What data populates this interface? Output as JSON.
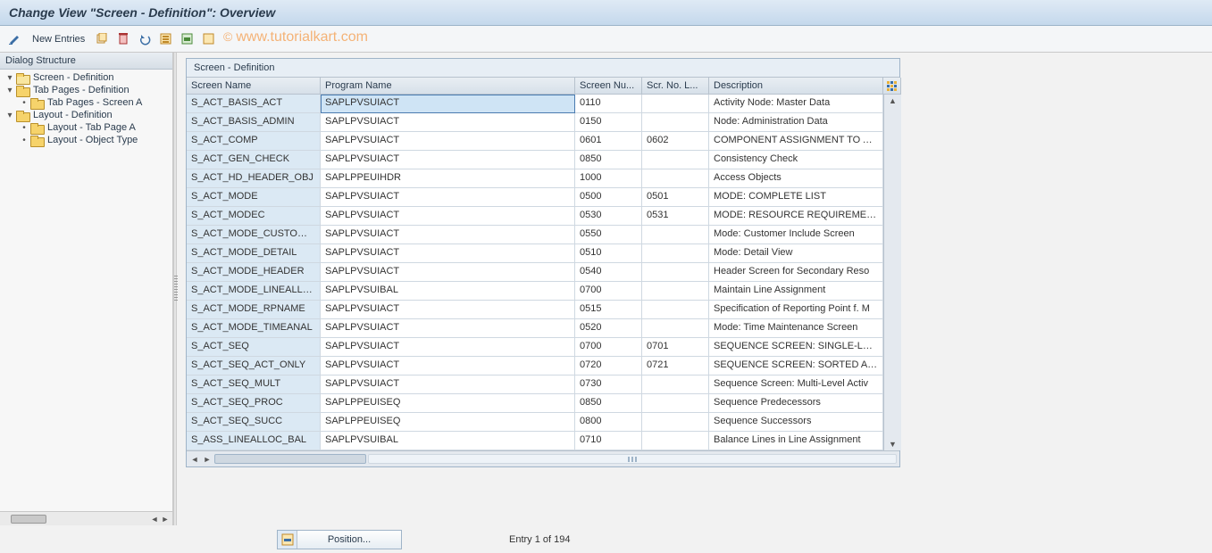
{
  "title": "Change View \"Screen - Definition\": Overview",
  "toolbar": {
    "new_entries": "New Entries"
  },
  "watermark": "www.tutorialkart.com",
  "tree": {
    "header": "Dialog Structure",
    "items": [
      {
        "indent": 0,
        "twisty": "▾",
        "label": "Screen - Definition",
        "selected": true
      },
      {
        "indent": 0,
        "twisty": "▾",
        "label": "Tab Pages - Definition",
        "selected": false
      },
      {
        "indent": 1,
        "twisty": "•",
        "label": "Tab Pages - Screen A",
        "selected": false
      },
      {
        "indent": 0,
        "twisty": "▾",
        "label": "Layout - Definition",
        "selected": false
      },
      {
        "indent": 1,
        "twisty": "•",
        "label": "Layout - Tab Page A",
        "selected": false
      },
      {
        "indent": 1,
        "twisty": "•",
        "label": "Layout - Object Type",
        "selected": false
      }
    ]
  },
  "grid": {
    "title": "Screen - Definition",
    "columns": [
      "Screen Name",
      "Program Name",
      "Screen Nu...",
      "Scr. No. L...",
      "Description"
    ],
    "rows": [
      {
        "name": "S_ACT_BASIS_ACT",
        "prog": "SAPLPVSUIACT",
        "scr": "0110",
        "scrl": "",
        "desc": "Activity Node: Master Data",
        "prog_sel": true
      },
      {
        "name": "S_ACT_BASIS_ADMIN",
        "prog": "SAPLPVSUIACT",
        "scr": "0150",
        "scrl": "",
        "desc": "Node: Administration Data"
      },
      {
        "name": "S_ACT_COMP",
        "prog": "SAPLPVSUIACT",
        "scr": "0601",
        "scrl": "0602",
        "desc": "COMPONENT ASSIGNMENT TO ACT"
      },
      {
        "name": "S_ACT_GEN_CHECK",
        "prog": "SAPLPVSUIACT",
        "scr": "0850",
        "scrl": "",
        "desc": "Consistency Check"
      },
      {
        "name": "S_ACT_HD_HEADER_OBJ",
        "prog": "SAPLPPEUIHDR",
        "scr": "1000",
        "scrl": "",
        "desc": "Access Objects"
      },
      {
        "name": "S_ACT_MODE",
        "prog": "SAPLPVSUIACT",
        "scr": "0500",
        "scrl": "0501",
        "desc": "MODE: COMPLETE LIST"
      },
      {
        "name": "S_ACT_MODEC",
        "prog": "SAPLPVSUIACT",
        "scr": "0530",
        "scrl": "0531",
        "desc": "MODE: RESOURCE REQUIREMENTS"
      },
      {
        "name": "S_ACT_MODE_CUSTOMER",
        "prog": "SAPLPVSUIACT",
        "scr": "0550",
        "scrl": "",
        "desc": "Mode: Customer Include Screen"
      },
      {
        "name": "S_ACT_MODE_DETAIL",
        "prog": "SAPLPVSUIACT",
        "scr": "0510",
        "scrl": "",
        "desc": "Mode: Detail View"
      },
      {
        "name": "S_ACT_MODE_HEADER",
        "prog": "SAPLPVSUIACT",
        "scr": "0540",
        "scrl": "",
        "desc": "Header Screen for Secondary Reso"
      },
      {
        "name": "S_ACT_MODE_LINEALLOC",
        "prog": "SAPLPVSUIBAL",
        "scr": "0700",
        "scrl": "",
        "desc": "Maintain Line Assignment"
      },
      {
        "name": "S_ACT_MODE_RPNAME",
        "prog": "SAPLPVSUIACT",
        "scr": "0515",
        "scrl": "",
        "desc": "Specification of Reporting Point f. M"
      },
      {
        "name": "S_ACT_MODE_TIMEANAL",
        "prog": "SAPLPVSUIACT",
        "scr": "0520",
        "scrl": "",
        "desc": "Mode: Time Maintenance Screen"
      },
      {
        "name": "S_ACT_SEQ",
        "prog": "SAPLPVSUIACT",
        "scr": "0700",
        "scrl": "0701",
        "desc": "SEQUENCE SCREEN: SINGLE-LEVEL"
      },
      {
        "name": "S_ACT_SEQ_ACT_ONLY",
        "prog": "SAPLPVSUIACT",
        "scr": "0720",
        "scrl": "0721",
        "desc": "SEQUENCE SCREEN: SORTED ACTI"
      },
      {
        "name": "S_ACT_SEQ_MULT",
        "prog": "SAPLPVSUIACT",
        "scr": "0730",
        "scrl": "",
        "desc": "Sequence Screen: Multi-Level Activ"
      },
      {
        "name": "S_ACT_SEQ_PROC",
        "prog": "SAPLPPEUISEQ",
        "scr": "0850",
        "scrl": "",
        "desc": "Sequence Predecessors"
      },
      {
        "name": "S_ACT_SEQ_SUCC",
        "prog": "SAPLPPEUISEQ",
        "scr": "0800",
        "scrl": "",
        "desc": "Sequence Successors"
      },
      {
        "name": "S_ASS_LINEALLOC_BAL",
        "prog": "SAPLPVSUIBAL",
        "scr": "0710",
        "scrl": "",
        "desc": "Balance Lines in Line Assignment"
      }
    ]
  },
  "footer": {
    "position_label": "Position...",
    "entry_text": "Entry 1 of 194"
  }
}
